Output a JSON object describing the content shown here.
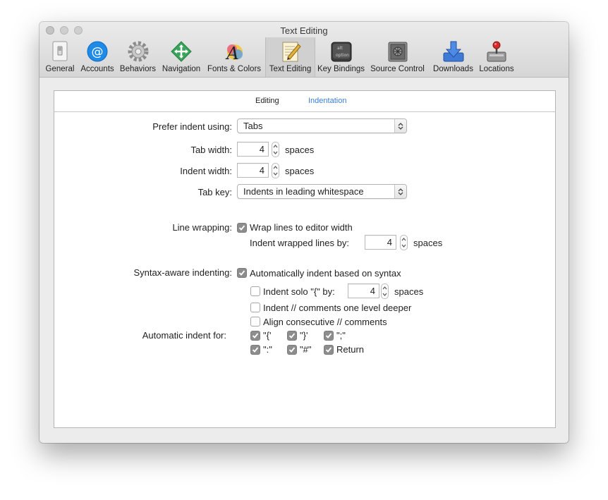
{
  "window": {
    "title": "Text Editing"
  },
  "toolbar": {
    "items": [
      {
        "label": "General",
        "icon": "general-icon"
      },
      {
        "label": "Accounts",
        "icon": "accounts-icon"
      },
      {
        "label": "Behaviors",
        "icon": "behaviors-icon"
      },
      {
        "label": "Navigation",
        "icon": "navigation-icon"
      },
      {
        "label": "Fonts & Colors",
        "icon": "fonts-colors-icon"
      },
      {
        "label": "Text Editing",
        "icon": "text-editing-icon",
        "selected": true
      },
      {
        "label": "Key Bindings",
        "icon": "key-bindings-icon"
      },
      {
        "label": "Source Control",
        "icon": "source-control-icon"
      },
      {
        "label": "Downloads",
        "icon": "downloads-icon"
      },
      {
        "label": "Locations",
        "icon": "locations-icon"
      }
    ]
  },
  "tabs": [
    {
      "label": "Editing",
      "selected": false
    },
    {
      "label": "Indentation",
      "selected": true
    }
  ],
  "indent": {
    "prefer_label": "Prefer indent using:",
    "prefer_value": "Tabs",
    "tab_width_label": "Tab width:",
    "tab_width_value": "4",
    "tab_width_unit": "spaces",
    "indent_width_label": "Indent width:",
    "indent_width_value": "4",
    "indent_width_unit": "spaces",
    "tab_key_label": "Tab key:",
    "tab_key_value": "Indents in leading whitespace"
  },
  "wrapping": {
    "label": "Line wrapping:",
    "wrap_check_label": "Wrap lines to editor width",
    "wrap_checked": true,
    "indent_wrapped_label": "Indent wrapped lines by:",
    "indent_wrapped_value": "4",
    "indent_wrapped_unit": "spaces"
  },
  "syntax": {
    "label": "Syntax-aware indenting:",
    "auto_label": "Automatically indent based on syntax",
    "auto_checked": true,
    "solo_label": "Indent solo \"{\" by:",
    "solo_checked": false,
    "solo_value": "4",
    "solo_unit": "spaces",
    "comments_deeper_label": "Indent // comments one level deeper",
    "comments_deeper_checked": false,
    "align_comments_label": "Align consecutive // comments",
    "align_comments_checked": false
  },
  "automatic": {
    "label": "Automatic indent for:",
    "items": [
      {
        "label": "\"{'",
        "checked": true
      },
      {
        "label": "\"}'",
        "checked": true
      },
      {
        "label": "\";\"",
        "checked": true
      },
      {
        "label": "\":\"",
        "checked": true
      },
      {
        "label": "\"#\"",
        "checked": true
      },
      {
        "label": "Return",
        "checked": true
      }
    ]
  }
}
